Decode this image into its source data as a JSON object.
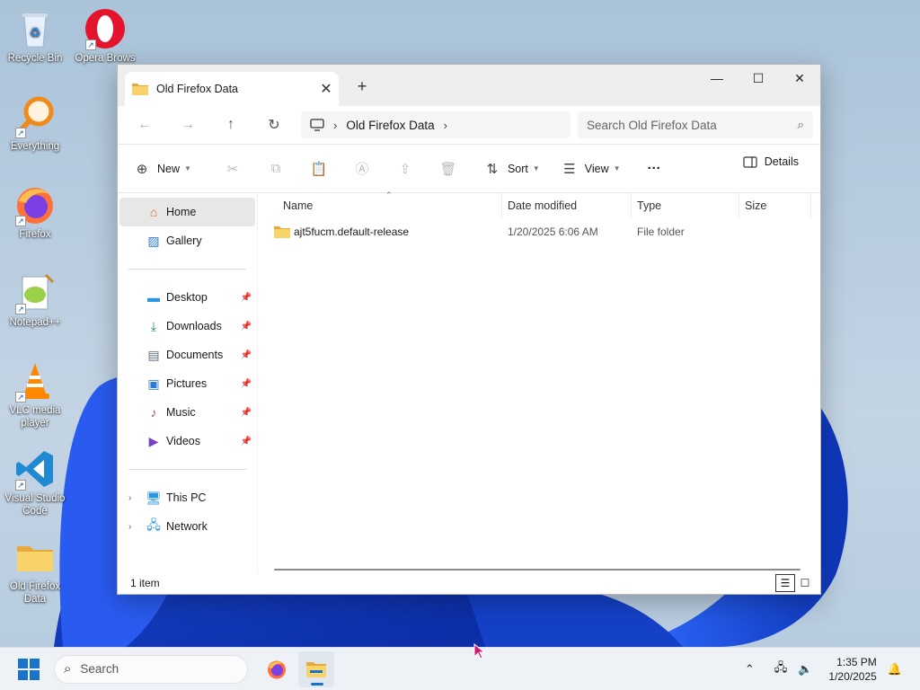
{
  "desktop": {
    "icons": [
      {
        "label": "Recycle Bin",
        "icon": "recycle-bin-icon"
      },
      {
        "label": "Opera Brows",
        "icon": "opera-icon"
      },
      {
        "label": "Everything",
        "icon": "everything-search-icon"
      },
      {
        "label": "Firefox",
        "icon": "firefox-icon"
      },
      {
        "label": "Notepad++",
        "icon": "notepadpp-icon"
      },
      {
        "label": "VLC media player",
        "icon": "vlc-icon"
      },
      {
        "label": "Visual Studio Code",
        "icon": "vscode-icon"
      },
      {
        "label": "Old Firefox Data",
        "icon": "folder-icon"
      }
    ]
  },
  "window": {
    "tab_title": "Old Firefox Data",
    "tab_close": "✕",
    "new_tab": "+",
    "address": {
      "breadcrumb": [
        "Old Firefox Data"
      ]
    },
    "search_placeholder": "Search Old Firefox Data",
    "command_bar": {
      "new_label": "New",
      "sort_label": "Sort",
      "view_label": "View",
      "more_label": "···",
      "details_label": "Details"
    },
    "nav_pane": {
      "top": [
        {
          "label": "Home",
          "icon": "home-icon",
          "selected": true
        },
        {
          "label": "Gallery",
          "icon": "gallery-icon",
          "selected": false
        }
      ],
      "pinned": [
        {
          "label": "Desktop",
          "icon": "desktop-folder-icon"
        },
        {
          "label": "Downloads",
          "icon": "downloads-icon"
        },
        {
          "label": "Documents",
          "icon": "documents-icon"
        },
        {
          "label": "Pictures",
          "icon": "pictures-icon"
        },
        {
          "label": "Music",
          "icon": "music-icon"
        },
        {
          "label": "Videos",
          "icon": "videos-icon"
        }
      ],
      "bottom": [
        {
          "label": "This PC",
          "icon": "this-pc-icon"
        },
        {
          "label": "Network",
          "icon": "network-icon"
        }
      ]
    },
    "columns": {
      "name": "Name",
      "date": "Date modified",
      "type": "Type",
      "size": "Size"
    },
    "files": [
      {
        "name": "ajt5fucm.default-release",
        "date": "1/20/2025 6:06 AM",
        "type": "File folder",
        "size": ""
      }
    ],
    "status": "1 item"
  },
  "taskbar": {
    "search_placeholder": "Search",
    "apps": [
      {
        "name": "Firefox",
        "icon": "firefox-icon",
        "active": false
      },
      {
        "name": "File Explorer",
        "icon": "file-explorer-icon",
        "active": true
      }
    ],
    "time": "1:35 PM",
    "date": "1/20/2025"
  },
  "colors": {
    "accent": "#1a73c8",
    "folder": "#f5c84c"
  }
}
